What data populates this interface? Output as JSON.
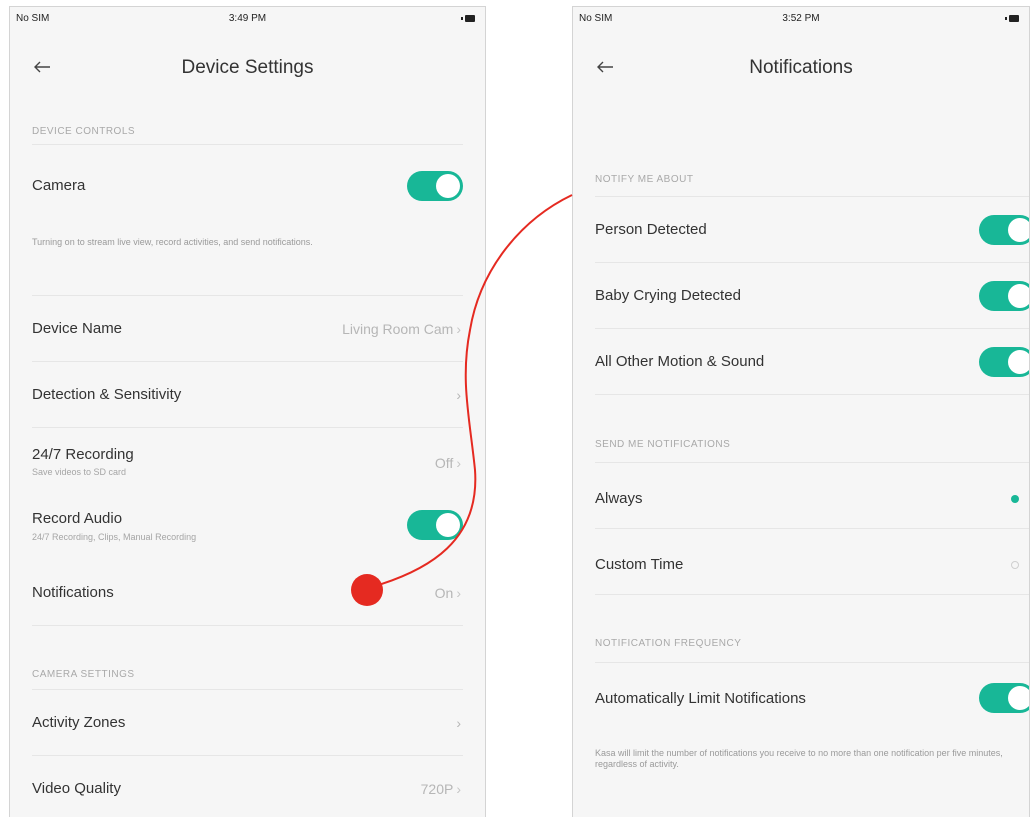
{
  "colors": {
    "accent": "#18b797",
    "annotation": "#e52a21"
  },
  "left": {
    "status": {
      "carrier": "No SIM",
      "time": "3:49 PM"
    },
    "title": "Device Settings",
    "device_controls_header": "DEVICE CONTROLS",
    "camera": {
      "label": "Camera",
      "on": true,
      "description": "Turning on to stream live view, record activities, and send notifications."
    },
    "device_name": {
      "label": "Device Name",
      "value": "Living Room Cam"
    },
    "detection": {
      "label": "Detection & Sensitivity"
    },
    "recording": {
      "label": "24/7 Recording",
      "sub": "Save videos to SD card",
      "value": "Off"
    },
    "record_audio": {
      "label": "Record Audio",
      "sub": "24/7 Recording, Clips, Manual Recording",
      "on": true
    },
    "notifications": {
      "label": "Notifications",
      "value": "On"
    },
    "camera_settings_header": "CAMERA SETTINGS",
    "activity_zones": {
      "label": "Activity Zones"
    },
    "video_quality": {
      "label": "Video Quality",
      "value": "720P"
    },
    "chevron": "›"
  },
  "right": {
    "status": {
      "carrier": "No SIM",
      "time": "3:52 PM"
    },
    "title": "Notifications",
    "notify_header": "NOTIFY ME ABOUT",
    "person": {
      "label": "Person Detected",
      "on": true
    },
    "baby": {
      "label": "Baby Crying Detected",
      "on": true
    },
    "motion": {
      "label": "All Other Motion & Sound",
      "on": true
    },
    "send_header": "SEND ME NOTIFICATIONS",
    "always": {
      "label": "Always",
      "selected": true
    },
    "custom": {
      "label": "Custom Time",
      "selected": false
    },
    "frequency_header": "NOTIFICATION FREQUENCY",
    "auto_limit": {
      "label": "Automatically Limit Notifications",
      "on": true
    },
    "auto_limit_desc": "Kasa will limit the number of notifications you receive to no more than one notification per five minutes, regardless of activity."
  }
}
